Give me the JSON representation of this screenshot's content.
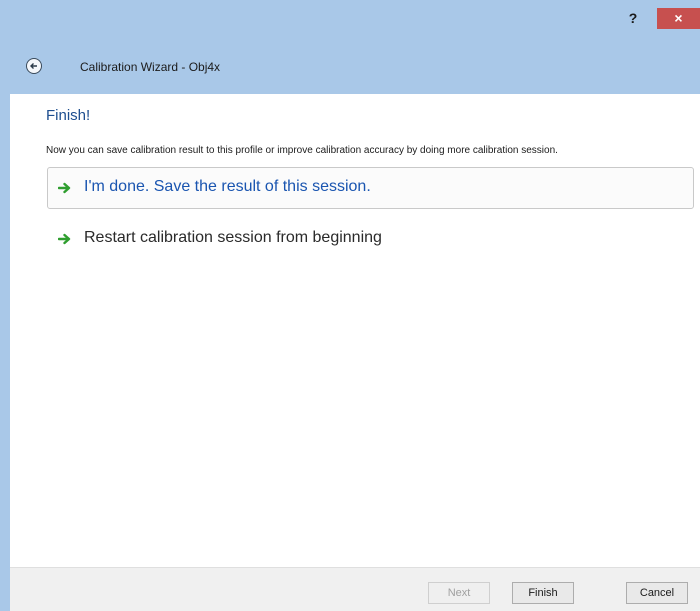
{
  "window": {
    "help_label": "?",
    "close_label": "×"
  },
  "header": {
    "title": "Calibration Wizard - Obj4x"
  },
  "page": {
    "title": "Finish!",
    "description": "Now you can save calibration result to this profile or improve calibration accuracy by doing more calibration session.",
    "options": [
      {
        "label": "I'm done. Save the result of this session.",
        "selected": true
      },
      {
        "label": "Restart calibration session from beginning",
        "selected": false
      }
    ]
  },
  "footer": {
    "next_label": "Next",
    "finish_label": "Finish",
    "cancel_label": "Cancel"
  },
  "colors": {
    "titlebar": "#a9c8e8",
    "close_button": "#c7504f",
    "arrow_green": "#2f9e2f",
    "link_blue": "#1a55b0"
  },
  "icons": {
    "back": "back-arrow-icon",
    "option_arrow": "green-arrow-icon"
  }
}
